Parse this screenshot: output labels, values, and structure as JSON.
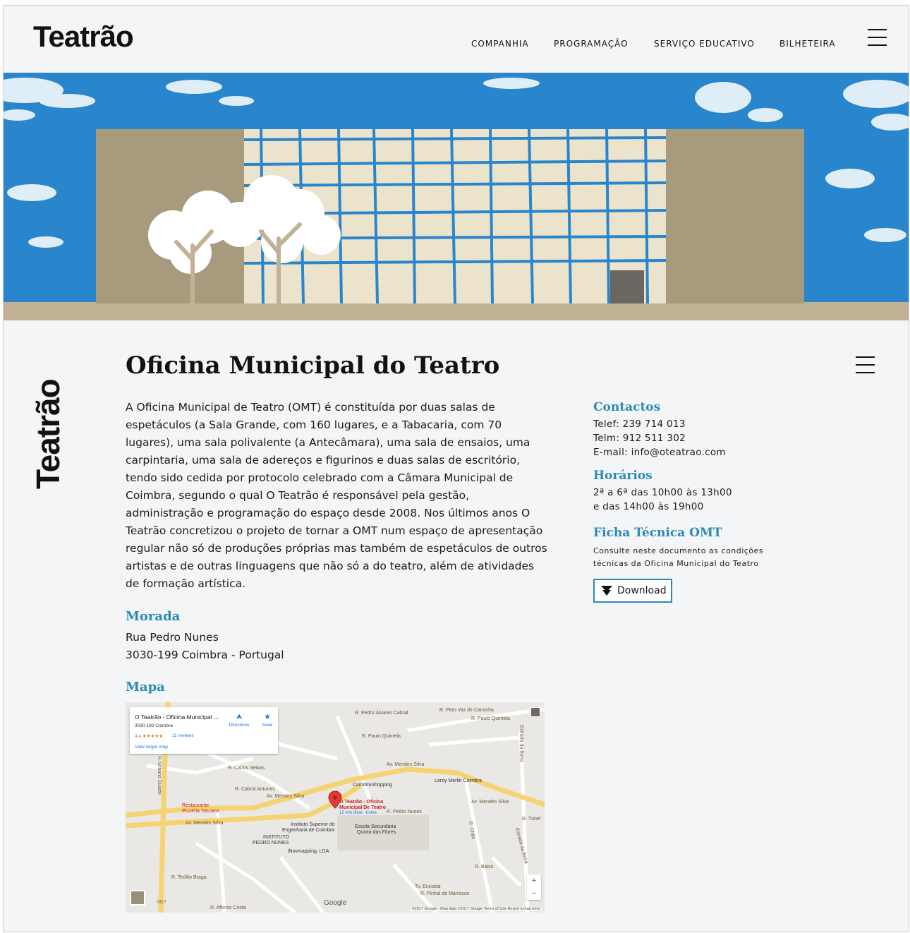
{
  "header": {
    "logo": "Teatrão",
    "nav": [
      "COMPANHIA",
      "PROGRAMAÇÃO",
      "SERVIÇO EDUCATIVO",
      "BILHETEIRA"
    ]
  },
  "side_logo": "Teatrão",
  "main": {
    "title": "Oficina Municipal do Teatro",
    "paragraph": "A Oficina Municipal de Teatro (OMT) é constituída por duas salas de espetáculos (a Sala Grande, com 160 lugares, e a Tabacaria, com 70 lugares), uma sala polivalente (a Antecâmara), uma sala de ensaios, uma carpintaria, uma sala de adereços e figurinos e duas salas de escritório, tendo sido cedida por protocolo celebrado com a Câmara Municipal de Coimbra, segundo o qual O Teatrão é responsável pela gestão, administração e programação do espaço desde 2008. Nos últimos anos O Teatrão concretizou o projeto de tornar a OMT num espaço de apresentação regular não só de produções próprias mas também de espetáculos de outros artistas e de outras linguagens que não só a do teatro, além de atividades de formação artística.",
    "morada_heading": "Morada",
    "address_line1": "Rua Pedro Nunes",
    "address_line2": "3030-199 Coimbra - Portugal",
    "mapa_heading": "Mapa"
  },
  "sidebar": {
    "contactos_heading": "Contactos",
    "telef": "Telef: 239 714 013",
    "telm": "Telm: 912 511 302",
    "email": "E-mail: info@oteatrao.com",
    "horarios_heading": "Horários",
    "horario1": "2ª a 6ª das 10h00 às 13h00",
    "horario2": "e das 14h00 às 19h00",
    "ficha_heading": "Ficha Técnica OMT",
    "ficha_line1": "Consulte neste documento as condições",
    "ficha_line2": "técnicas da Oficina Municipal do Teatro",
    "download_label": "Download"
  },
  "map": {
    "card_title": "O Teatrão - Oficina Municipal ...",
    "card_sub": "3030-193 Coimbra",
    "card_rating": "4.4 ★★★★★",
    "card_reviews": "11 reviews",
    "card_larger": "View larger map",
    "directions": "Directions",
    "save": "Save",
    "marker_label1": "O Teatrão - Oficina",
    "marker_label2": "Municipal De Teatro",
    "marker_label3": "12 min drive · home",
    "labels": {
      "pedro_alvares": "R. Pedro Álvares Cabral",
      "pero_vaz": "R. Pero Vaz de Caminha",
      "paulo_quintela1": "R. Paulo Quintela",
      "paulo_quintela2": "R. Paulo Quintela",
      "mendes_silva1": "Av. Mendes Silva",
      "mendes_silva2": "Av. Mendes Silva",
      "mendes_silva3": "Av. Mendes Silva",
      "mendes_silva4": "Av. Mendes Silva",
      "coimbra_shopping": "CoimbraShopping",
      "leroy": "Leroy Merlin Coimbra",
      "pedro_nunes": "R. Pedro Nunes",
      "instituto": "Instituto Superior de",
      "instituto2": "Engenharia de Coimbra",
      "escola": "Escola Secundária",
      "escola2": "Quinta das Flores",
      "instituto_pn": "INSTITUTO",
      "instituto_pn2": "PEDRO NUNES",
      "inovmapping": "iNovmapping, LDA",
      "restaurante": "Restaurante",
      "restaurante2": "Pizzeria Toscana",
      "cabral_antunes": "R. Cabral Antunes",
      "carlos_seixas": "R. Carlos Seixas",
      "urbano_duarte": "R. Urbano Duarte",
      "estrada_beira": "Estrada da Beira",
      "estrada_beira2": "Estrada da Beira",
      "teofilo_braga": "R. Teófilo Braga",
      "afonso_costa": "R. Afonso Costa",
      "tv_encosta": "Tv. Encosta",
      "pinhal": "R. Pinhal de Marrocos",
      "baixo": "R. Baixo",
      "chas": "R. Chãs",
      "tunel": "R. Túnel",
      "n17": "N17"
    },
    "google": "Google",
    "footer": "©2017 Google - Map data ©2017 Google    Terms of Use    Report a map error"
  },
  "colors": {
    "accent": "#2a8bb5",
    "sky": "#2a86cc",
    "building": "#c1b296",
    "background": "#f4f5f7"
  },
  "icons": [
    "menu-icon",
    "download-arrow-icon",
    "directions-icon",
    "save-star-icon",
    "map-pin-icon"
  ]
}
